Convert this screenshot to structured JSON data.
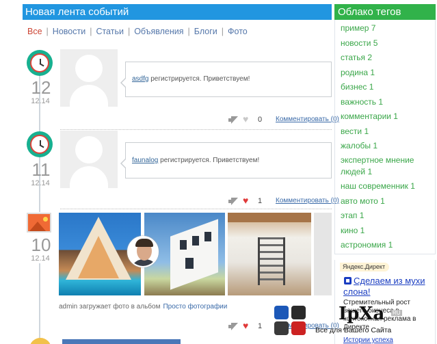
{
  "feed": {
    "title": "Новая лента событий",
    "tabs": [
      {
        "label": "Все",
        "active": true
      },
      {
        "label": "Новости"
      },
      {
        "label": "Статьи"
      },
      {
        "label": "Объявления"
      },
      {
        "label": "Блоги"
      },
      {
        "label": "Фото"
      }
    ],
    "events": [
      {
        "icon": "clock-icon",
        "day": "12",
        "date": "12.14",
        "user": "asdfg",
        "text": "регистрируется. Приветствуем!",
        "liked": false,
        "likes": "0",
        "comment_label": "Комментировать (0)"
      },
      {
        "icon": "clock-icon",
        "day": "11",
        "date": "12.14",
        "user": "faunalog",
        "text": "регистрируется. Приветствуем!",
        "liked": true,
        "likes": "1",
        "comment_label": "Комментировать (0)"
      },
      {
        "icon": "photo-icon",
        "day": "10",
        "date": "12.14",
        "caption": "admin загружает фото в альбом",
        "caption_link": "Просто фотографии",
        "liked": true,
        "likes": "1",
        "comment_label": "Комментировать (0)"
      }
    ]
  },
  "tags": {
    "title": "Облако тегов",
    "items": [
      "пример 7",
      "новости 5",
      "статья 2",
      "родина 1",
      "бизнес 1",
      "важность 1",
      "комментарии 1",
      "вести 1",
      "жалобы 1",
      "экспертное мнение",
      "людей 1",
      "наш современник 1",
      "авто мото 1",
      "этап 1",
      "кино 1",
      "астрономия 1"
    ]
  },
  "direct": {
    "label": "Яндекс.Директ",
    "link": "Сделаем из мухи слона!",
    "text": "Стремительный рост вашего бизнеса в контекстная реклама в Директе",
    "more": "Истории успеха"
  },
  "watermark": {
    "logo": "IpXa",
    "ru": "RU",
    "tagline": "Все для Вашего Сайта"
  },
  "colors": {
    "feed_header": "#2196e0",
    "tags_header": "#31b24a",
    "tag_text": "#39a648",
    "link": "#3a6aa8",
    "heart": "#e03a3a",
    "clock_ring": "#17b090"
  }
}
